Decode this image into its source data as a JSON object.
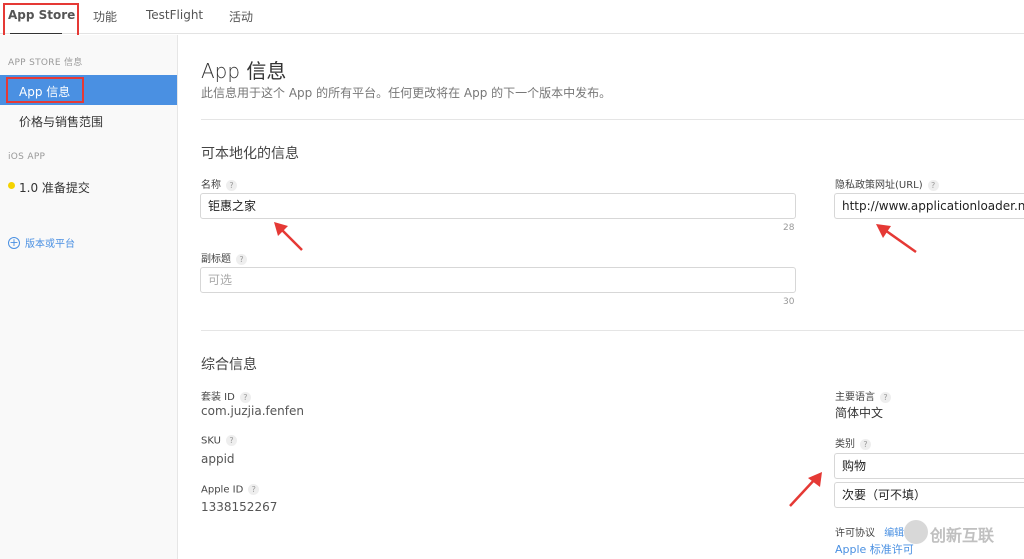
{
  "topnav": {
    "tabs": [
      "App Store",
      "功能",
      "TestFlight",
      "活动"
    ]
  },
  "sidebar": {
    "section_store": "APP STORE 信息",
    "item_appinfo": "App 信息",
    "item_price": "价格与销售范围",
    "section_ios": "iOS APP",
    "item_version": "1.0 准备提交",
    "add_platform": "版本或平台",
    "status_color": "#f5d300"
  },
  "main": {
    "title": "App 信息",
    "description": "此信息用于这个 App 的所有平台。任何更改将在 App 的下一个版本中发布。",
    "localizable": {
      "title": "可本地化的信息",
      "name_label": "名称",
      "name_value": "钜惠之家",
      "name_counter": "28",
      "subtitle_label": "副标题",
      "subtitle_placeholder": "可选",
      "subtitle_counter": "30",
      "privacy_label": "隐私政策网址(URL)",
      "privacy_value": "http://www.applicationloader.net/"
    },
    "general": {
      "title": "综合信息",
      "bundle_label": "套装 ID",
      "bundle_value": "com.juzjia.fenfen",
      "sku_label": "SKU",
      "sku_value": "appid",
      "appleid_label": "Apple ID",
      "appleid_value": "1338152267",
      "language_label": "主要语言",
      "language_value": "简体中文",
      "category_label": "类别",
      "category_primary": "购物",
      "category_secondary": "次要（可不填）",
      "license_label": "许可协议",
      "license_edit": "编辑",
      "license_value": "Apple 标准许可"
    },
    "help_glyph": "?"
  },
  "watermark": "创新互联",
  "colors": {
    "accent": "#4a90e2",
    "annotation": "#e53935"
  }
}
